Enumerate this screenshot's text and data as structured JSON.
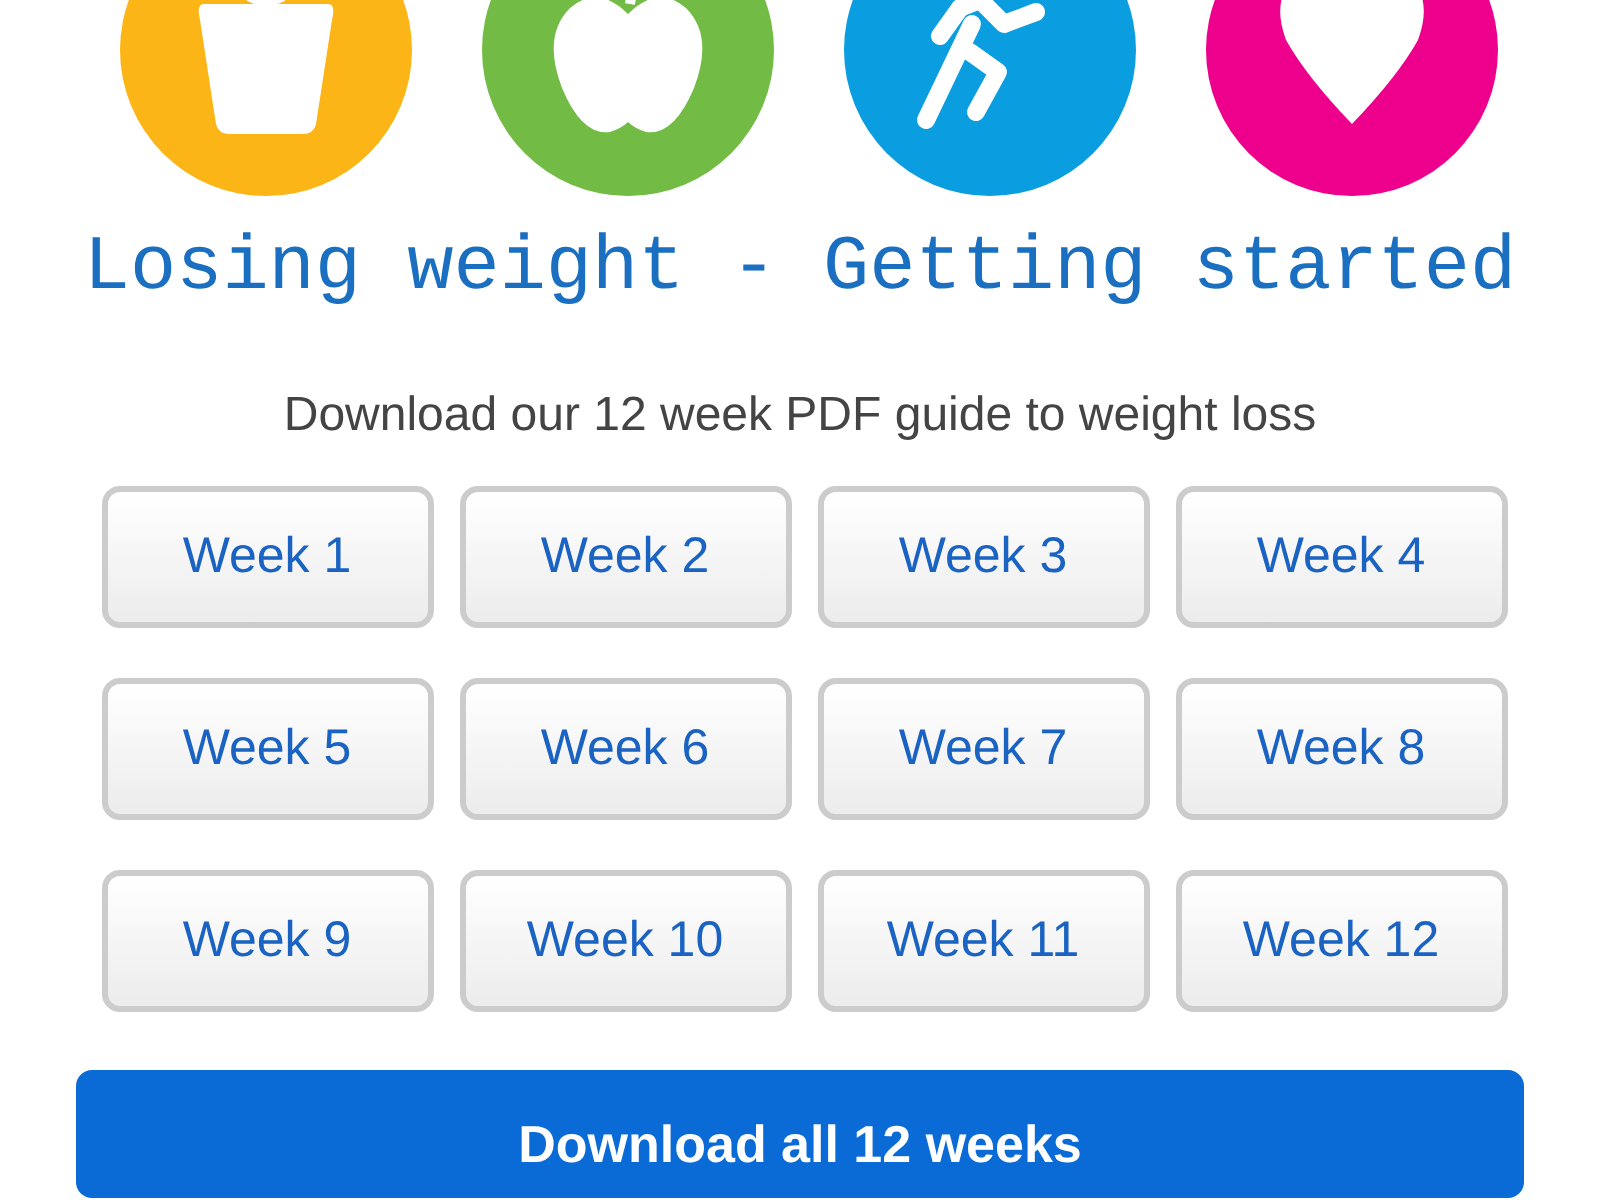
{
  "icons": [
    {
      "kind": "weight",
      "color": "#fbb517"
    },
    {
      "kind": "apple",
      "color": "#72bb44"
    },
    {
      "kind": "runner",
      "color": "#0a9ee0"
    },
    {
      "kind": "heart",
      "color": "#ec008c"
    }
  ],
  "title": "Losing weight - Getting started",
  "subtitle": "Download our 12 week PDF guide to weight loss",
  "weeks": [
    "Week 1",
    "Week 2",
    "Week 3",
    "Week 4",
    "Week 5",
    "Week 6",
    "Week 7",
    "Week 8",
    "Week 9",
    "Week 10",
    "Week 11",
    "Week 12"
  ],
  "download_all": "Download all 12 weeks"
}
